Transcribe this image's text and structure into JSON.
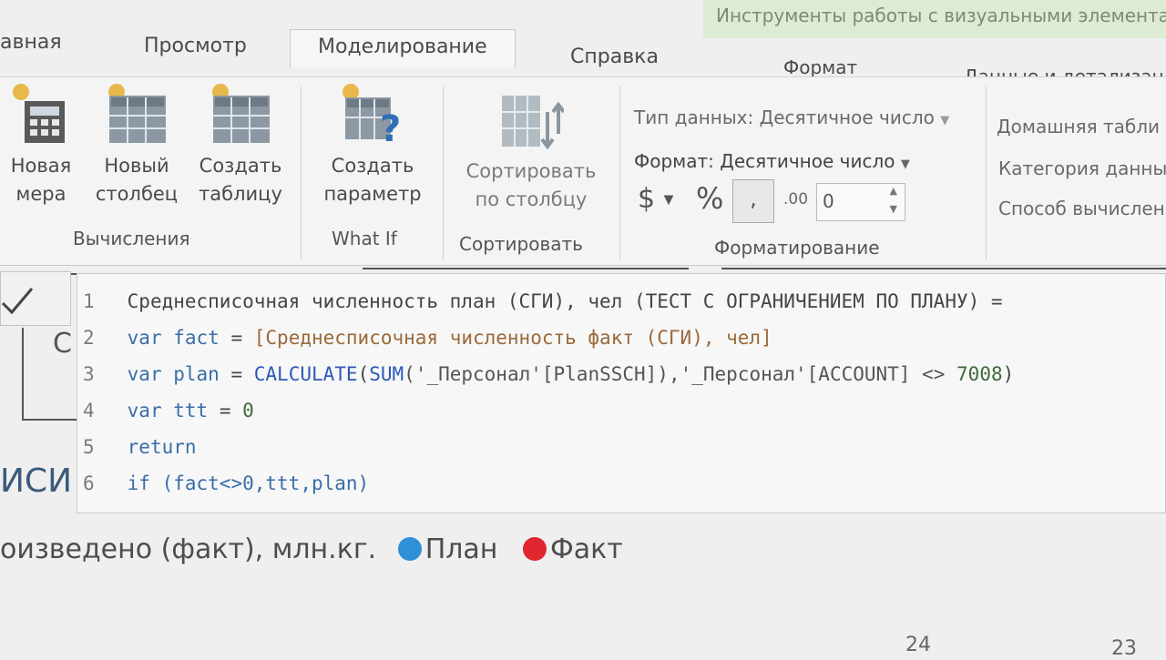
{
  "tabs": {
    "home": "авная",
    "view": "Просмотр",
    "modeling": "Моделирование",
    "help": "Справка",
    "format": "Формат",
    "data_drill": "Данные и детализаци"
  },
  "context_banner": "Инструменты работы с визуальными элемента",
  "ribbon": {
    "calc": {
      "new_measure": "Новая\nмера",
      "new_column": "Новый\nстолбец",
      "new_table": "Создать\nтаблицу",
      "group": "Вычисления"
    },
    "whatif": {
      "new_param": "Создать\nпараметр",
      "group": "What If"
    },
    "sort": {
      "sort_by_col": "Сортировать\nпо столбцу",
      "group": "Сортировать"
    },
    "formatting": {
      "data_type_label": "Тип данных:",
      "data_type_value": "Десятичное число",
      "format_label": "Формат:",
      "format_value": "Десятичное число",
      "currency_symbol": "$",
      "percent_symbol": "%",
      "comma_symbol": ",",
      "decimals_symbol": ".00",
      "decimal_places": "0",
      "group": "Форматирование"
    },
    "properties": {
      "home_table": "Домашняя табли",
      "data_category": "Категория данных",
      "summarize_by": "Способ вычислен"
    }
  },
  "formula": {
    "line1": "Среднесписочная численность план (СГИ), чел (ТЕСТ С ОГРАНИЧЕНИЕМ ПО ПЛАНУ) =",
    "line2_kw": "var",
    "line2_name": "fact",
    "line2_eq": " = ",
    "line2_ref": "[Среднесписочная численность факт (СГИ), чел]",
    "line3_kw": "var",
    "line3_name": "plan",
    "line3_eq": " = ",
    "line3_fn1": "CALCULATE",
    "line3_fn2": "SUM",
    "line3_rest1": "('_Персонал'[PlanSSCH]),'_Персонал'[ACCOUNT] <> ",
    "line3_num": "7008",
    "line3_close": ")",
    "line4_kw": "var",
    "line4_name": "ttt",
    "line4_eq": " = ",
    "line4_num": "0",
    "line5_kw": "return",
    "line6_kw": "if",
    "line6_rest": " (fact<>0,ttt,plan)",
    "line_numbers": [
      "1",
      "2",
      "3",
      "4",
      "5",
      "6"
    ]
  },
  "background": {
    "fragment_left": "С",
    "fragment_left2": "ИСИ"
  },
  "legend": {
    "caption": "оизведено (факт), млн.кг.",
    "plan": "План",
    "fact": "Факт",
    "plan_color": "#2f8fd8",
    "fact_color": "#e0262e"
  },
  "axis": {
    "tick1": "24",
    "tick2": "23"
  }
}
